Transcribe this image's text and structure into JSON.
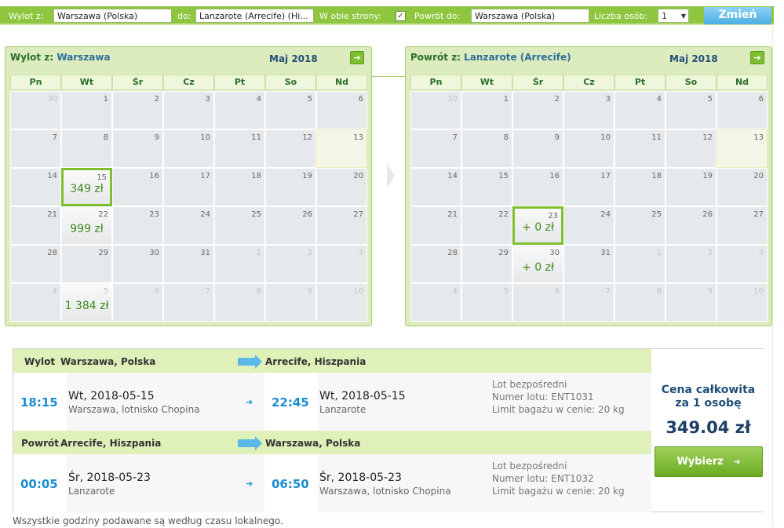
{
  "search": {
    "from_label": "Wylot z:",
    "from_value": "Warszawa (Polska)",
    "to_label": "do:",
    "to_value": "Lanzarote (Arrecife) (Hi...",
    "both_ways_label": "W obie strony:",
    "both_ways_checked": "✓",
    "return_label": "Powrót do:",
    "return_value": "Warszawa (Polska)",
    "persons_label": "Liczba osób:",
    "persons_value": "1",
    "submit_label": "Zmień"
  },
  "weekdays": [
    "Pn",
    "Wt",
    "Śr",
    "Cz",
    "Pt",
    "So",
    "Nd"
  ],
  "outbound_calendar": {
    "prefix": "Wylot z:",
    "city": "Warszawa",
    "month": "Maj 2018",
    "weeks": [
      [
        {
          "d": "30",
          "m": true
        },
        {
          "d": "1"
        },
        {
          "d": "2"
        },
        {
          "d": "3"
        },
        {
          "d": "4"
        },
        {
          "d": "5"
        },
        {
          "d": "6"
        }
      ],
      [
        {
          "d": "7"
        },
        {
          "d": "8"
        },
        {
          "d": "9"
        },
        {
          "d": "10"
        },
        {
          "d": "11"
        },
        {
          "d": "12"
        },
        {
          "d": "13",
          "hl": true
        }
      ],
      [
        {
          "d": "14"
        },
        {
          "d": "15",
          "p": "349 zł",
          "sel": true
        },
        {
          "d": "16"
        },
        {
          "d": "17"
        },
        {
          "d": "18"
        },
        {
          "d": "19"
        },
        {
          "d": "20"
        }
      ],
      [
        {
          "d": "21"
        },
        {
          "d": "22",
          "p": "999 zł"
        },
        {
          "d": "23"
        },
        {
          "d": "24"
        },
        {
          "d": "25"
        },
        {
          "d": "26"
        },
        {
          "d": "27"
        }
      ],
      [
        {
          "d": "28"
        },
        {
          "d": "29"
        },
        {
          "d": "30"
        },
        {
          "d": "31"
        },
        {
          "d": "1",
          "m": true
        },
        {
          "d": "2",
          "m": true
        },
        {
          "d": "3",
          "m": true
        }
      ],
      [
        {
          "d": "4",
          "m": true
        },
        {
          "d": "5",
          "m": true,
          "p": "1 384 zł"
        },
        {
          "d": "6",
          "m": true
        },
        {
          "d": "7",
          "m": true
        },
        {
          "d": "8",
          "m": true
        },
        {
          "d": "9",
          "m": true
        },
        {
          "d": "10",
          "m": true
        }
      ]
    ]
  },
  "return_calendar": {
    "prefix": "Powrót z:",
    "city": "Lanzarote (Arrecife)",
    "month": "Maj 2018",
    "weeks": [
      [
        {
          "d": "30",
          "m": true
        },
        {
          "d": "1"
        },
        {
          "d": "2"
        },
        {
          "d": "3"
        },
        {
          "d": "4"
        },
        {
          "d": "5"
        },
        {
          "d": "6"
        }
      ],
      [
        {
          "d": "7"
        },
        {
          "d": "8"
        },
        {
          "d": "9"
        },
        {
          "d": "10"
        },
        {
          "d": "11"
        },
        {
          "d": "12"
        },
        {
          "d": "13",
          "hl": true
        }
      ],
      [
        {
          "d": "14"
        },
        {
          "d": "15"
        },
        {
          "d": "16"
        },
        {
          "d": "17"
        },
        {
          "d": "18"
        },
        {
          "d": "19"
        },
        {
          "d": "20"
        }
      ],
      [
        {
          "d": "21"
        },
        {
          "d": "22"
        },
        {
          "d": "23",
          "p": "+ 0 zł",
          "sel": true
        },
        {
          "d": "24"
        },
        {
          "d": "25"
        },
        {
          "d": "26"
        },
        {
          "d": "27"
        }
      ],
      [
        {
          "d": "28"
        },
        {
          "d": "29"
        },
        {
          "d": "30",
          "p": "+ 0 zł"
        },
        {
          "d": "31"
        },
        {
          "d": "1",
          "m": true
        },
        {
          "d": "2",
          "m": true
        },
        {
          "d": "3",
          "m": true
        }
      ],
      [
        {
          "d": "4",
          "m": true
        },
        {
          "d": "5",
          "m": true
        },
        {
          "d": "6",
          "m": true
        },
        {
          "d": "7",
          "m": true
        },
        {
          "d": "8",
          "m": true
        },
        {
          "d": "9",
          "m": true
        },
        {
          "d": "10",
          "m": true
        }
      ]
    ]
  },
  "outbound": {
    "label": "Wylot",
    "from": "Warszawa, Polska",
    "to": "Arrecife, Hiszpania",
    "dep_time": "18:15",
    "dep_day": "Wt,",
    "dep_date": "2018-05-15",
    "dep_place": "Warszawa, lotnisko Chopina",
    "arr_time": "22:45",
    "arr_day": "Wt,",
    "arr_date": "2018-05-15",
    "arr_place": "Lanzarote",
    "info1": "Lot bezpośredni",
    "info2": "Numer lotu: ENT1031",
    "info3": "Limit bagażu w cenie: 20 kg"
  },
  "inbound": {
    "label": "Powrót",
    "from": "Arrecife, Hiszpania",
    "to": "Warszawa, Polska",
    "dep_time": "00:05",
    "dep_day": "Śr,",
    "dep_date": "2018-05-23",
    "dep_place": "Lanzarote",
    "arr_time": "06:50",
    "arr_day": "Śr,",
    "arr_date": "2018-05-23",
    "arr_place": "Warszawa, lotnisko Chopina",
    "info1": "Lot bezpośredni",
    "info2": "Numer lotu: ENT1032",
    "info3": "Limit bagażu w cenie: 20 kg"
  },
  "price": {
    "label_line1": "Cena całkowita",
    "label_line2": "za 1 osobę",
    "value": "349.04 zł",
    "button": "Wybierz",
    "button_arrow": "➔"
  },
  "footer_note": "Wszystkie godziny podawane są według czasu lokalnego."
}
